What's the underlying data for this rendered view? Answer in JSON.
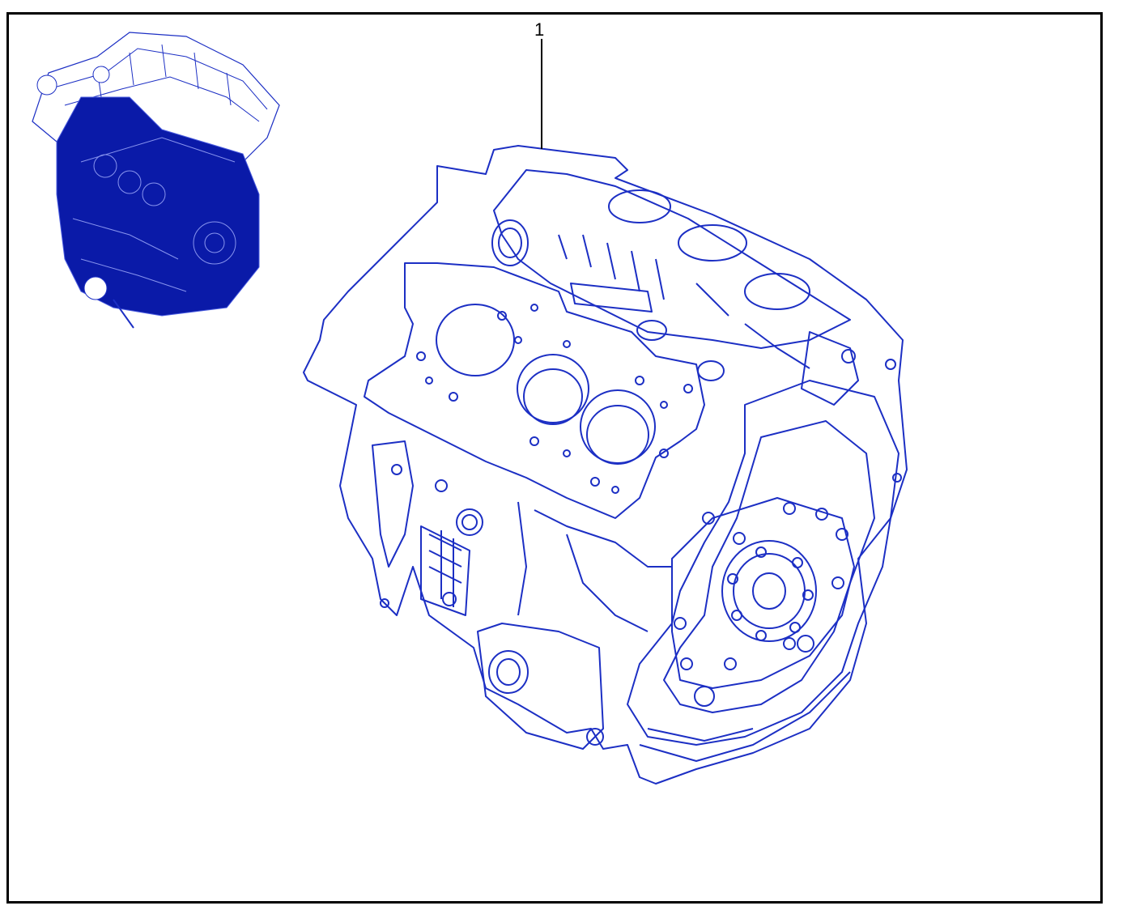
{
  "callout": {
    "number": "1"
  },
  "colors": {
    "line": "#1c2fc4",
    "fill_thumbnail": "#0a1aa8",
    "frame": "#000000"
  },
  "parts": [
    {
      "callout": "1",
      "name": "engine-block"
    }
  ]
}
